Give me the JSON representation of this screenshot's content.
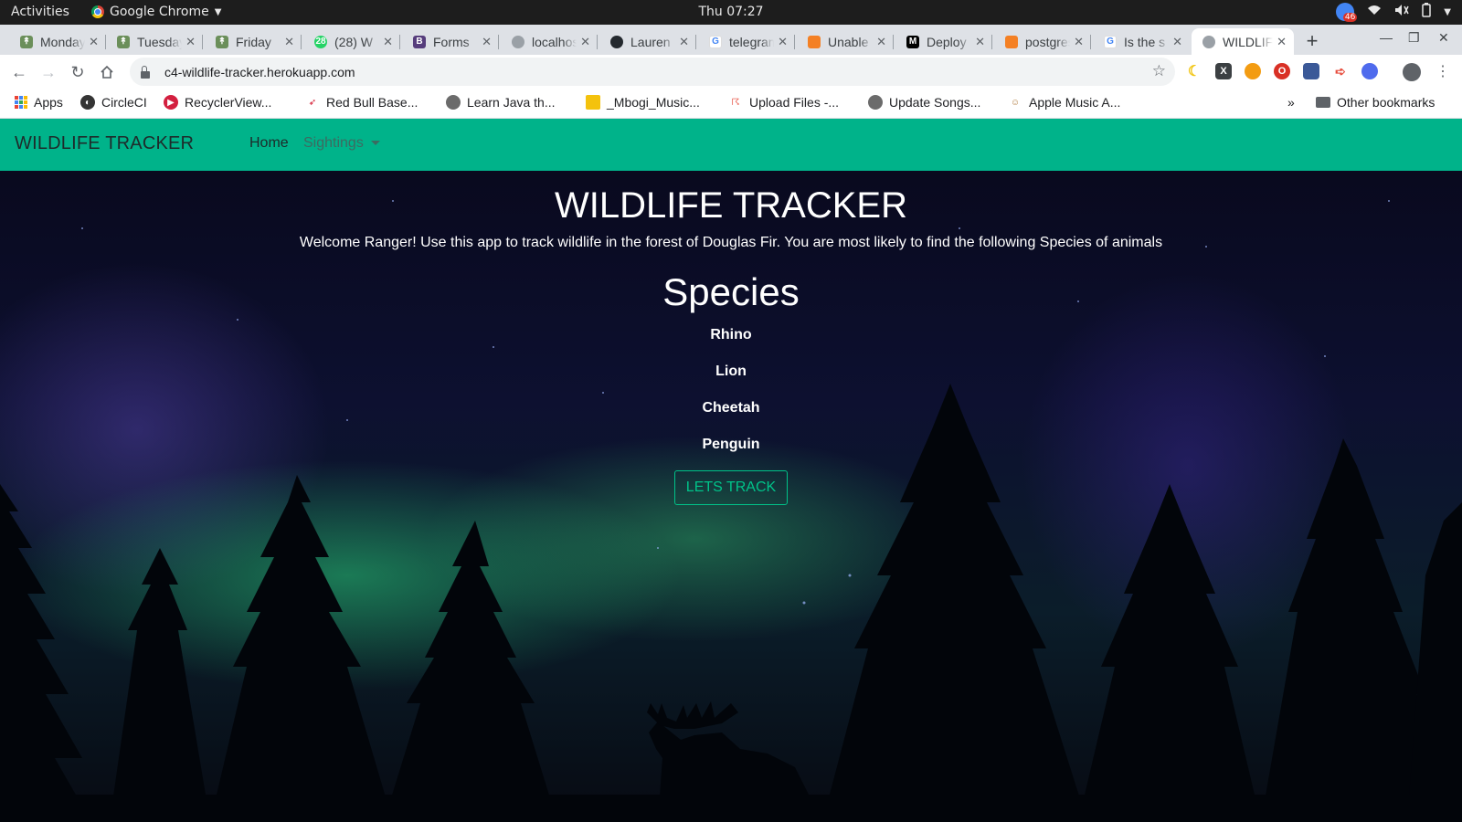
{
  "os": {
    "activities": "Activities",
    "app_name": "Google Chrome",
    "clock": "Thu 07:27",
    "notification_count": "46"
  },
  "tabs": [
    {
      "title": "Monday"
    },
    {
      "title": "Tuesday"
    },
    {
      "title": "Friday"
    },
    {
      "title": "(28) W",
      "badge": "28"
    },
    {
      "title": "Forms"
    },
    {
      "title": "localhost"
    },
    {
      "title": "Lauren"
    },
    {
      "title": "telegram"
    },
    {
      "title": "Unable"
    },
    {
      "title": "Deploy"
    },
    {
      "title": "postgres"
    },
    {
      "title": "Is the s"
    },
    {
      "title": "WILDLIFE",
      "active": true
    }
  ],
  "toolbar": {
    "url": "c4-wildlife-tracker.herokuapp.com"
  },
  "bookmarks": [
    {
      "label": "Apps"
    },
    {
      "label": "CircleCI"
    },
    {
      "label": "RecyclerView..."
    },
    {
      "label": "Red Bull Base..."
    },
    {
      "label": "Learn Java th..."
    },
    {
      "label": "_Mbogi_Music..."
    },
    {
      "label": "Upload Files -..."
    },
    {
      "label": "Update Songs..."
    },
    {
      "label": "Apple Music A..."
    }
  ],
  "bookmarks_overflow": "»",
  "other_bookmarks": "Other bookmarks",
  "site": {
    "brand": "WILDLIFE TRACKER",
    "nav": {
      "home": "Home",
      "sightings": "Sightings"
    },
    "title": "WILDLIFE TRACKER",
    "welcome": "Welcome Ranger! Use this app to track wildlife in the forest of Douglas Fir. You are most likely to find the following Species of animals",
    "species_heading": "Species",
    "species": [
      "Rhino",
      "Lion",
      "Cheetah",
      "Penguin"
    ],
    "cta": "LETS TRACK"
  },
  "colors": {
    "navbar": "#00b38a",
    "cta": "#00c389",
    "tab_strip": "#dee1e6"
  }
}
